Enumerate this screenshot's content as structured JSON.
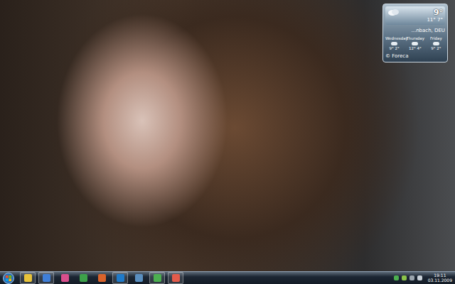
{
  "weather": {
    "temp": "9°",
    "range": "11° 7°",
    "location": "...nbach, DEU",
    "credit": "© Foreca",
    "days": [
      {
        "name": "Wednesday",
        "temps": "9° 2°"
      },
      {
        "name": "Thursday",
        "temps": "12° 4°"
      },
      {
        "name": "Friday",
        "temps": "9° 2°"
      }
    ]
  },
  "taskbar": {
    "apps": [
      {
        "running": true,
        "color": "#e8c33a"
      },
      {
        "running": true,
        "color": "#3f7fd8"
      },
      {
        "running": false,
        "color": "#d94f8c"
      },
      {
        "running": false,
        "color": "#3da14a"
      },
      {
        "running": false,
        "color": "#d9632b"
      },
      {
        "running": true,
        "color": "#1f7ac9"
      },
      {
        "running": false,
        "color": "#5a8fc0"
      },
      {
        "running": true,
        "color": "#4caf50"
      },
      {
        "running": true,
        "color": "#e35b4b"
      }
    ],
    "tray": [
      {
        "color": "#4caf50"
      },
      {
        "color": "#8bc34a"
      },
      {
        "color": "#9aa4ad"
      },
      {
        "color": "#c8d0d8"
      }
    ],
    "time": "19:11",
    "date": "03.11.2009"
  }
}
